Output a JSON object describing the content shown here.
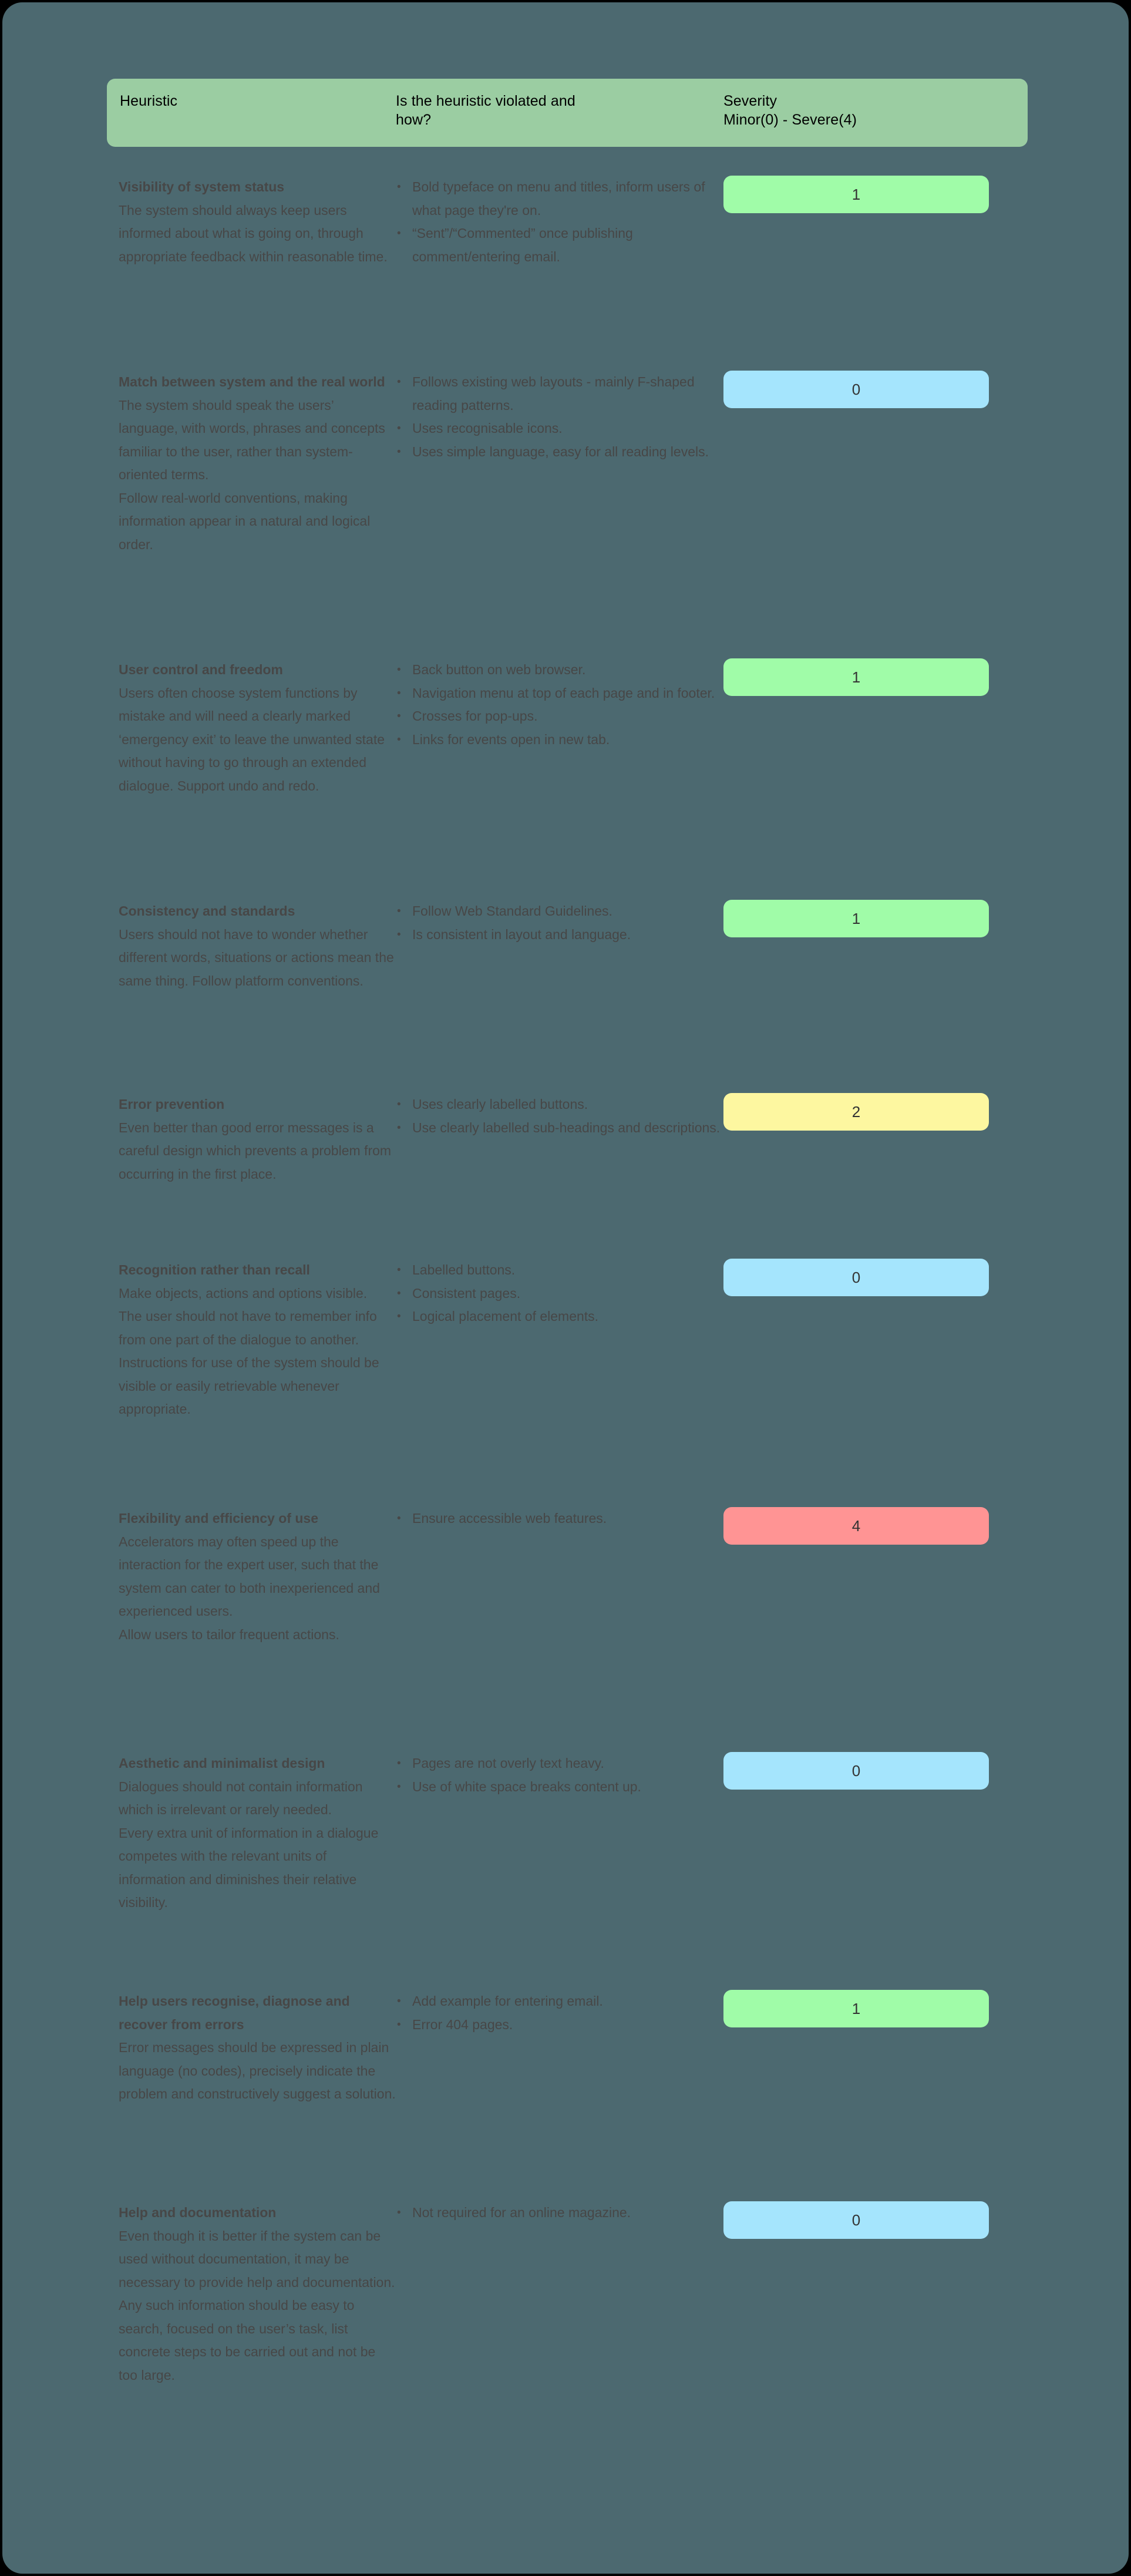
{
  "colors": {
    "page_background": "#4c6970",
    "header_card": "#9bcda2",
    "text": "#474747",
    "header_text": "#000000",
    "severity_0": "#a5e5fd",
    "severity_1": "#a0fca8",
    "severity_2": "#fdf7a0",
    "severity_4": "#ff9494"
  },
  "header": {
    "col_heuristic": "Heuristic",
    "col_violation": "Is the heuristic violated and\nhow?",
    "col_severity": "Severity\nMinor(0) - Severe(4)"
  },
  "rows": [
    {
      "title": "Visibility of system status",
      "body": "The system should always keep users informed about what is going on, through appropriate feedback within reasonable time.",
      "bullets": [
        "Bold typeface on menu and titles, inform users of what page they're on.",
        "“Sent”/“Commented” once publishing comment/entering email."
      ],
      "severity": "1",
      "severity_color": "#a0fca8"
    },
    {
      "title": "Match between system and the real world",
      "body": "The system should speak the users’ language, with words, phrases and concepts familiar to the user, rather than system-oriented terms.\nFollow real-world conventions, making information appear in a natural and logical order.",
      "bullets": [
        "Follows existing web layouts - mainly F-shaped reading patterns.",
        "Uses recognisable icons.",
        "Uses simple language, easy for all reading levels."
      ],
      "severity": "0",
      "severity_color": "#a5e5fd"
    },
    {
      "title": "User control and freedom",
      "body": "Users often choose system functions by mistake and will need a clearly marked ‘emergency exit’ to leave the unwanted state without having to go through an extended dialogue. Support undo and redo.",
      "bullets": [
        "Back button on web browser.",
        "Navigation menu at top of each page and in footer.",
        "Crosses for pop-ups.",
        "Links for events open in new tab."
      ],
      "severity": "1",
      "severity_color": "#a0fca8"
    },
    {
      "title": "Consistency and standards",
      "body": "Users should not have to wonder whether different words, situations or actions mean the same thing. Follow platform conventions.",
      "bullets": [
        "Follow Web Standard Guidelines.",
        "Is consistent in layout and language."
      ],
      "severity": "1",
      "severity_color": "#a0fca8"
    },
    {
      "title": "Error prevention",
      "body": "Even better than good error messages is a careful design which prevents a problem from occurring in the first place.",
      "bullets": [
        "Uses clearly labelled buttons.",
        "Use clearly labelled sub-headings and descriptions."
      ],
      "severity": "2",
      "severity_color": "#fdf7a0"
    },
    {
      "title": "Recognition rather than recall",
      "body": "Make objects, actions and options visible.\nThe user should not have to remember info from one part of the dialogue to another.\nInstructions for use of the system should be visible or easily retrievable whenever appropriate.",
      "bullets": [
        "Labelled buttons.",
        "Consistent pages.",
        "Logical placement of elements."
      ],
      "severity": "0",
      "severity_color": "#a5e5fd"
    },
    {
      "title": "Flexibility and efficiency of use",
      "body": "Accelerators may often speed up the interaction for the expert user, such that the system can cater to both inexperienced and experienced users.\nAllow users to tailor frequent actions.",
      "bullets": [
        "Ensure accessible web features."
      ],
      "severity": "4",
      "severity_color": "#ff9494"
    },
    {
      "title": "Aesthetic and minimalist design",
      "body": "Dialogues should not contain information which is irrelevant or rarely needed.\nEvery extra unit of information in a dialogue competes with the relevant units of information and diminishes their relative visibility.",
      "bullets": [
        "Pages are not overly text heavy.",
        "Use of white space breaks content up."
      ],
      "severity": "0",
      "severity_color": "#a5e5fd"
    },
    {
      "title": "Help users recognise, diagnose and recover from errors",
      "body": "Error messages should be expressed in plain language (no codes), precisely indicate the problem and constructively suggest a solution.",
      "bullets": [
        "Add example for entering email.",
        "Error 404 pages."
      ],
      "severity": "1",
      "severity_color": "#a0fca8"
    },
    {
      "title": "Help and documentation",
      "body": "Even though it is better if the system can be used without documentation, it may be necessary to provide help and documentation.\nAny such information should be easy to search, focused on the user’s task, list concrete steps to be carried out and not be too large.",
      "bullets": [
        "Not required for an online magazine."
      ],
      "severity": "0",
      "severity_color": "#a5e5fd"
    }
  ],
  "row_offsets": [
    295,
    627,
    1117,
    1528,
    1857,
    2139,
    2562,
    2979,
    3384,
    3744
  ]
}
